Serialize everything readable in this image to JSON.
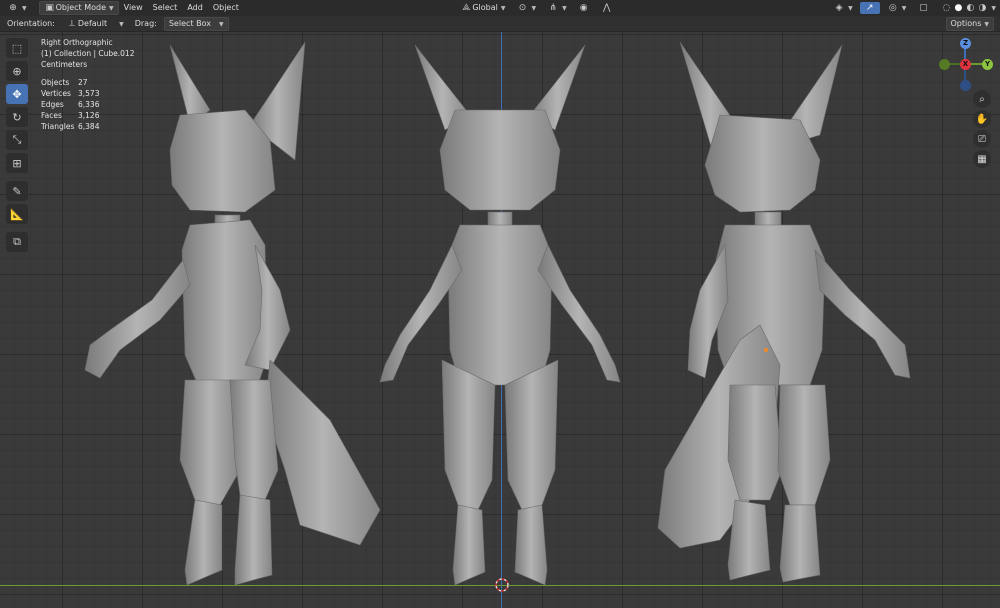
{
  "header": {
    "mode": "Object Mode",
    "menus": [
      "View",
      "Select",
      "Add",
      "Object"
    ],
    "transform_orientation": "Global"
  },
  "tool_header": {
    "orientation_label": "Orientation:",
    "orientation_value": "Default",
    "drag_label": "Drag:",
    "drag_value": "Select Box",
    "options_label": "Options"
  },
  "viewport": {
    "view_name": "Right Orthographic",
    "collection": "(1) Collection | Cube.012",
    "units": "Centimeters",
    "stats": [
      {
        "label": "Objects",
        "value": "27"
      },
      {
        "label": "Vertices",
        "value": "3,573"
      },
      {
        "label": "Edges",
        "value": "6,336"
      },
      {
        "label": "Faces",
        "value": "3,126"
      },
      {
        "label": "Triangles",
        "value": "6,384"
      }
    ]
  },
  "gizmo": {
    "z": "Z",
    "x": "X",
    "y": "Y"
  },
  "colors": {
    "z_axis": "#3e6fb6",
    "y_axis": "#6d9a2e",
    "x_axis": "#e0333f",
    "active_tool": "#4772b3",
    "mesh": "#9a9a9a"
  },
  "icons": [
    "select-box-icon",
    "cursor-icon",
    "move-icon",
    "rotate-icon",
    "scale-icon",
    "transform-icon",
    "annotate-icon",
    "measure-icon",
    "add-cube-icon",
    "zoom-icon",
    "hand-icon",
    "camera-icon",
    "grid-icon"
  ]
}
